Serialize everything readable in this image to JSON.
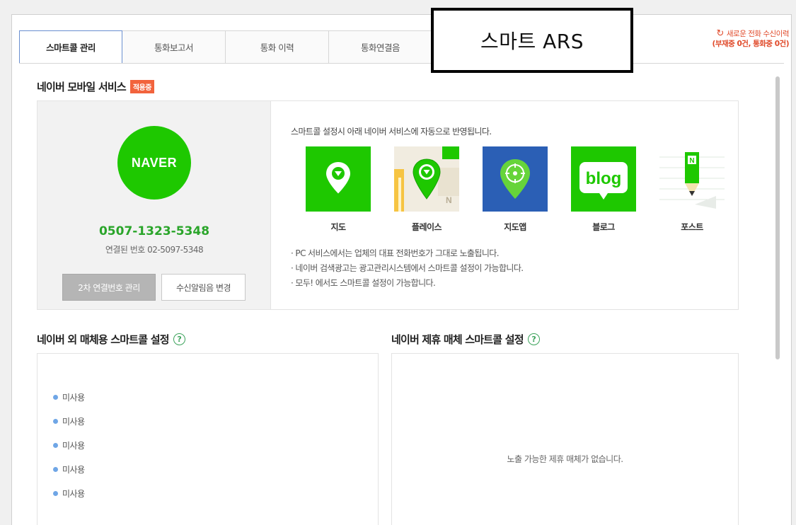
{
  "tabs": [
    "스마트콜 관리",
    "통화보고서",
    "통화 이력",
    "통화연결음"
  ],
  "refresh": {
    "line1": "새로운 전화 수신이력",
    "line2": "(부재중 0건, 통화중 0건)",
    "icon": "refresh-icon"
  },
  "overlay_label": "스마트 ARS",
  "naver_section": {
    "title": "네이버 모바일 서비스",
    "badge": "적용중",
    "logo_text": "NAVER",
    "phone": "0507-1323-5348",
    "linked": "연결된 번호 02-5097-5348",
    "btn_secondary": "2차 연결번호 관리",
    "btn_alert": "수신알림음 변경",
    "desc": "스마트콜 설정시 아래 네이버 서비스에 자동으로 반영됩니다.",
    "services": [
      {
        "label": "지도",
        "icon": "map-pin-icon"
      },
      {
        "label": "플레이스",
        "icon": "place-icon"
      },
      {
        "label": "지도앱",
        "icon": "map-app-icon"
      },
      {
        "label": "블로그",
        "icon": "blog-icon"
      },
      {
        "label": "포스트",
        "icon": "post-icon"
      }
    ],
    "blog_text": "blog",
    "post_text": "N",
    "notes": [
      "· PC 서비스에서는 업체의 대표 전화번호가 그대로 노출됩니다.",
      "· 네이버 검색광고는 광고관리시스템에서 스마트콜 설정이 가능합니다.",
      "· 모두! 에서도 스마트콜 설정이 가능합니다."
    ]
  },
  "external_section": {
    "title": "네이버 외 매체용 스마트콜 설정",
    "items": [
      "미사용",
      "미사용",
      "미사용",
      "미사용",
      "미사용"
    ]
  },
  "partner_section": {
    "title": "네이버 제휴 매체 스마트콜 설정",
    "empty": "노출 가능한 제휴 매체가 없습니다."
  },
  "colors": {
    "naver_green": "#1ec800",
    "accent_orange": "#f2633d",
    "map_app_blue": "#2b5fb5"
  }
}
